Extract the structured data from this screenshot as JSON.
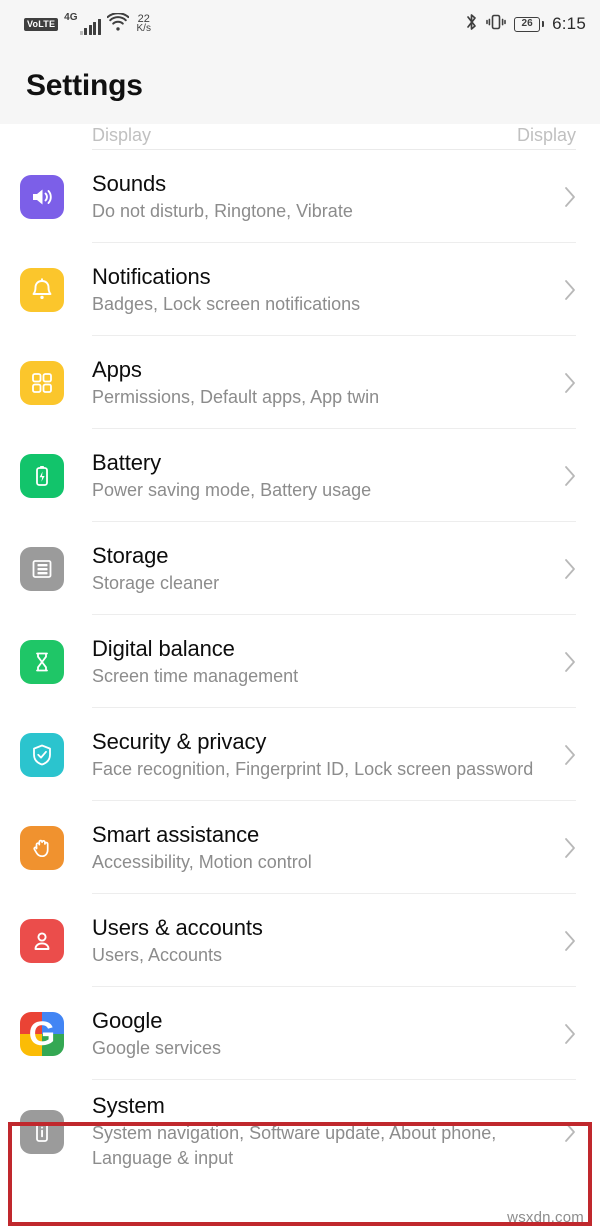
{
  "status_bar": {
    "volte_label": "VoLTE",
    "network_label": "4G",
    "signal_icon": "signal-bars-icon",
    "wifi_icon": "wifi-icon",
    "data_speed_value": "22",
    "data_speed_unit": "K/s",
    "bluetooth_icon": "bluetooth-icon",
    "vibrate_icon": "vibrate-icon",
    "battery_percent": "26",
    "clock": "6:15"
  },
  "header": {
    "title": "Settings"
  },
  "list": {
    "cut_off_row": {
      "left_fragment": "Display",
      "right_fragment": "Display"
    },
    "items": [
      {
        "title": "Sounds",
        "subtitle": "Do not disturb, Ringtone, Vibrate",
        "icon": "speaker-icon",
        "icon_color": "#7C5FE8",
        "name": "sounds"
      },
      {
        "title": "Notifications",
        "subtitle": "Badges, Lock screen notifications",
        "icon": "bell-icon",
        "icon_color": "#FBC62C",
        "name": "notifications"
      },
      {
        "title": "Apps",
        "subtitle": "Permissions, Default apps, App twin",
        "icon": "grid-apps-icon",
        "icon_color": "#FBC62C",
        "name": "apps"
      },
      {
        "title": "Battery",
        "subtitle": "Power saving mode, Battery usage",
        "icon": "battery-bolt-icon",
        "icon_color": "#12C46B",
        "name": "battery"
      },
      {
        "title": "Storage",
        "subtitle": "Storage cleaner",
        "icon": "storage-list-icon",
        "icon_color": "#9B9B9B",
        "name": "storage"
      },
      {
        "title": "Digital balance",
        "subtitle": "Screen time management",
        "icon": "hourglass-icon",
        "icon_color": "#1FC667",
        "name": "digital-balance"
      },
      {
        "title": "Security & privacy",
        "subtitle": "Face recognition, Fingerprint ID, Lock screen password",
        "icon": "shield-check-icon",
        "icon_color": "#2BC4CE",
        "name": "security-privacy"
      },
      {
        "title": "Smart assistance",
        "subtitle": "Accessibility, Motion control",
        "icon": "hand-icon",
        "icon_color": "#F0922F",
        "name": "smart-assistance"
      },
      {
        "title": "Users & accounts",
        "subtitle": "Users, Accounts",
        "icon": "person-icon",
        "icon_color": "#EB4D4B",
        "name": "users-accounts"
      },
      {
        "title": "Google",
        "subtitle": "Google services",
        "icon": "google-g-icon",
        "icon_color": "#FFFFFF",
        "icon_letter": "G",
        "name": "google"
      },
      {
        "title": "System",
        "subtitle": "System navigation, Software update, About phone, Language & input",
        "icon": "phone-info-icon",
        "icon_color": "#9B9B9B",
        "name": "system"
      }
    ],
    "chevron_icon": "chevron-right-icon"
  },
  "annotation": {
    "highlight_color": "#c0282d",
    "highlight_target": "system",
    "watermark": "wsxdn.com"
  }
}
